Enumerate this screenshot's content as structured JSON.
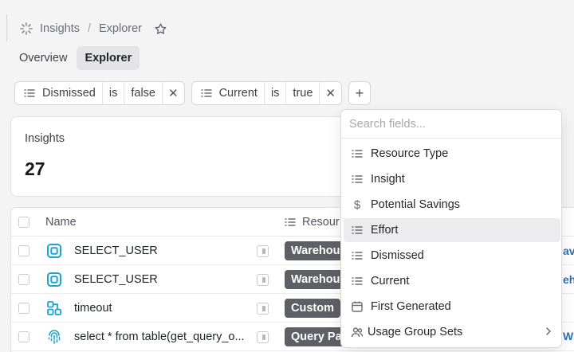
{
  "breadcrumb": {
    "root": "Insights",
    "separator": "/",
    "current": "Explorer"
  },
  "tabs": [
    {
      "label": "Overview",
      "active": false
    },
    {
      "label": "Explorer",
      "active": true
    }
  ],
  "filters": [
    {
      "field": "Dismissed",
      "op": "is",
      "value": "false"
    },
    {
      "field": "Current",
      "op": "is",
      "value": "true"
    }
  ],
  "add_filter_label": "+",
  "summary": {
    "title": "Insights",
    "value": "27"
  },
  "table": {
    "headers": {
      "name": "Name",
      "resource": "Resour"
    },
    "rows": [
      {
        "icon": "warehouse-square-icon",
        "name": "SELECT_USER",
        "badge": "Warehou",
        "peek": "av"
      },
      {
        "icon": "warehouse-square-icon",
        "name": "SELECT_USER",
        "badge": "Warehou",
        "peek": "eh"
      },
      {
        "icon": "custom-nodes-icon",
        "name": "timeout",
        "badge": "Custom",
        "peek": ""
      },
      {
        "icon": "fingerprint-icon",
        "name": "select * from table(get_query_o...",
        "badge": "Query Pa",
        "peek": "W"
      }
    ]
  },
  "dropdown": {
    "search_placeholder": "Search fields...",
    "items": [
      {
        "label": "Resource Type",
        "icon": "list-icon"
      },
      {
        "label": "Insight",
        "icon": "list-icon"
      },
      {
        "label": "Potential Savings",
        "icon": "dollar-icon"
      },
      {
        "label": "Effort",
        "icon": "list-icon"
      },
      {
        "label": "Dismissed",
        "icon": "list-icon"
      },
      {
        "label": "Current",
        "icon": "list-icon"
      },
      {
        "label": "First Generated",
        "icon": "calendar-icon"
      },
      {
        "label": "Usage Group Sets",
        "icon": "users-icon"
      }
    ],
    "hovered": "Effort"
  },
  "colors": {
    "accent_cyan": "#1ba5cf",
    "badge_gray": "#5f5f66",
    "link_blue": "#2c6fb7"
  }
}
